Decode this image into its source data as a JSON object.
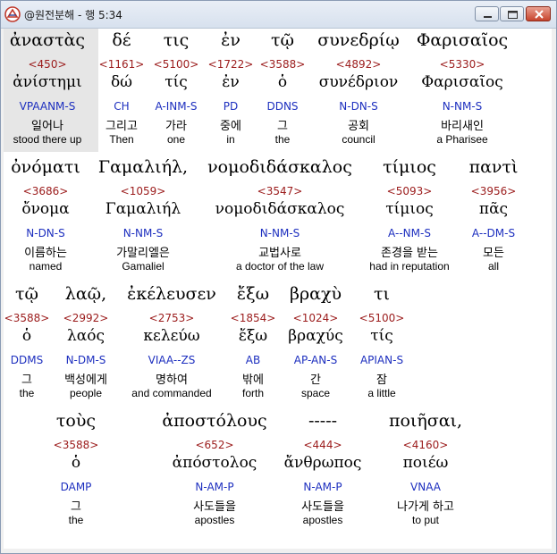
{
  "window": {
    "title": "@원전분해 - 행 5:34"
  },
  "rows": [
    {
      "words": [
        {
          "greek": "ἀναστὰς",
          "strong": "<450>",
          "lemma": "ἀνίστημι",
          "parse": "VPAANM-S",
          "korean": "일어나",
          "english": "stood there up"
        },
        {
          "greek": "δέ",
          "strong": "<1161>",
          "lemma": "δώ",
          "parse": "CH",
          "korean": "그리고",
          "english": "Then"
        },
        {
          "greek": "τις",
          "strong": "<5100>",
          "lemma": "τίς",
          "parse": "A-INM-S",
          "korean": "가라",
          "english": "one"
        },
        {
          "greek": "ἐν",
          "strong": "<1722>",
          "lemma": "ἐν",
          "parse": "PD",
          "korean": "중에",
          "english": "in"
        },
        {
          "greek": "τῷ",
          "strong": "<3588>",
          "lemma": "ὁ",
          "parse": "DDNS",
          "korean": "그",
          "english": "the"
        },
        {
          "greek": "συνεδρίῳ",
          "strong": "<4892>",
          "lemma": "συνέδριον",
          "parse": "N-DN-S",
          "korean": "공회",
          "english": "council"
        },
        {
          "greek": "Φαρισαῖος",
          "strong": "<5330>",
          "lemma": "Φαρισαῖος",
          "parse": "N-NM-S",
          "korean": "바리새인",
          "english": "a Pharisee"
        }
      ]
    },
    {
      "words": [
        {
          "greek": "ὀνόματι",
          "strong": "<3686>",
          "lemma": "ὄνομα",
          "parse": "N-DN-S",
          "korean": "이름하는",
          "english": "named"
        },
        {
          "greek": "Γαμαλιήλ,",
          "strong": "<1059>",
          "lemma": "Γαμαλιήλ",
          "parse": "N-NM-S",
          "korean": "가말리엘은",
          "english": "Gamaliel"
        },
        {
          "greek": "νομοδιδάσκαλος",
          "strong": "<3547>",
          "lemma": "νομοδιδάσκαλος",
          "parse": "N-NM-S",
          "korean": "교법사로",
          "english": "a doctor of the law"
        },
        {
          "greek": "τίμιος",
          "strong": "<5093>",
          "lemma": "τίμιος",
          "parse": "A--NM-S",
          "korean": "존경을 받는",
          "english": "had in reputation"
        },
        {
          "greek": "παντὶ",
          "strong": "<3956>",
          "lemma": "πᾶς",
          "parse": "A--DM-S",
          "korean": "모든",
          "english": "all"
        }
      ]
    },
    {
      "words": [
        {
          "greek": "τῷ",
          "strong": "<3588>",
          "lemma": "ὁ",
          "parse": "DDMS",
          "korean": "그",
          "english": "the"
        },
        {
          "greek": "λαῷ,",
          "strong": "<2992>",
          "lemma": "λαός",
          "parse": "N-DM-S",
          "korean": "백성에게",
          "english": "people"
        },
        {
          "greek": "ἐκέλευσεν",
          "strong": "<2753>",
          "lemma": "κελεύω",
          "parse": "VIAA--ZS",
          "korean": "명하여",
          "english": "and commanded"
        },
        {
          "greek": "ἔξω",
          "strong": "<1854>",
          "lemma": "ἔξω",
          "parse": "AB",
          "korean": "밖에",
          "english": "forth"
        },
        {
          "greek": "βραχὺ",
          "strong": "<1024>",
          "lemma": "βραχύς",
          "parse": "AP-AN-S",
          "korean": "간",
          "english": "space"
        },
        {
          "greek": "τι",
          "strong": "<5100>",
          "lemma": "τίς",
          "parse": "APIAN-S",
          "korean": "잠",
          "english": "a little"
        }
      ]
    },
    {
      "words": [
        {
          "greek": "τοὺς",
          "strong": "<3588>",
          "lemma": "ὁ",
          "parse": "DAMP",
          "korean": "그",
          "english": "the"
        },
        {
          "greek": "ἀποστόλους",
          "strong": "<652>",
          "lemma": "ἀπόστολος",
          "parse": "N-AM-P",
          "korean": "사도들을",
          "english": "apostles"
        },
        {
          "greek": "-----",
          "strong": "<444>",
          "lemma": "ἄνθρωπος",
          "parse": "N-AM-P",
          "korean": "사도들을",
          "english": "apostles"
        },
        {
          "greek": "ποιῆσαι,",
          "strong": "<4160>",
          "lemma": "ποιέω",
          "parse": "VNAA",
          "korean": "나가게 하고",
          "english": "to put"
        }
      ]
    }
  ]
}
